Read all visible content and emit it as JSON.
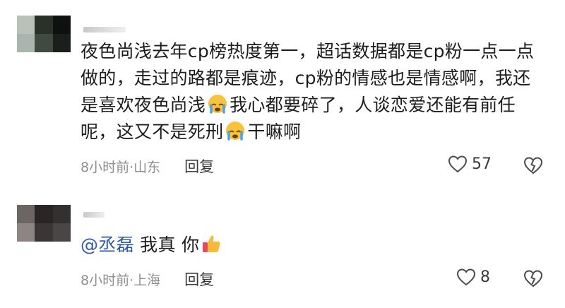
{
  "comments": [
    {
      "text_parts": [
        "夜色尚浅去年cp榜热度第一，超话数据都是cp粉一点一点做的，走过的路都是痕迹，cp粉的情感也是情感啊，我还是喜欢夜色尚浅",
        "我心都要碎了，人谈恋爱还能有前任呢，这又不是死刑",
        "干嘛啊"
      ],
      "emojis": [
        "crying-face",
        "crying-face"
      ],
      "meta": "8小时前·山东",
      "reply_label": "回复",
      "like_count": "57"
    },
    {
      "mention": "@丞磊",
      "text": "我真 你",
      "emoji": "thumbs-up",
      "meta": "8小时前·上海",
      "reply_label": "回复",
      "like_count": "8"
    }
  ],
  "colors": {
    "mention": "#2f5aa8",
    "meta": "#8e8e8e",
    "text": "#1c1c1c"
  }
}
